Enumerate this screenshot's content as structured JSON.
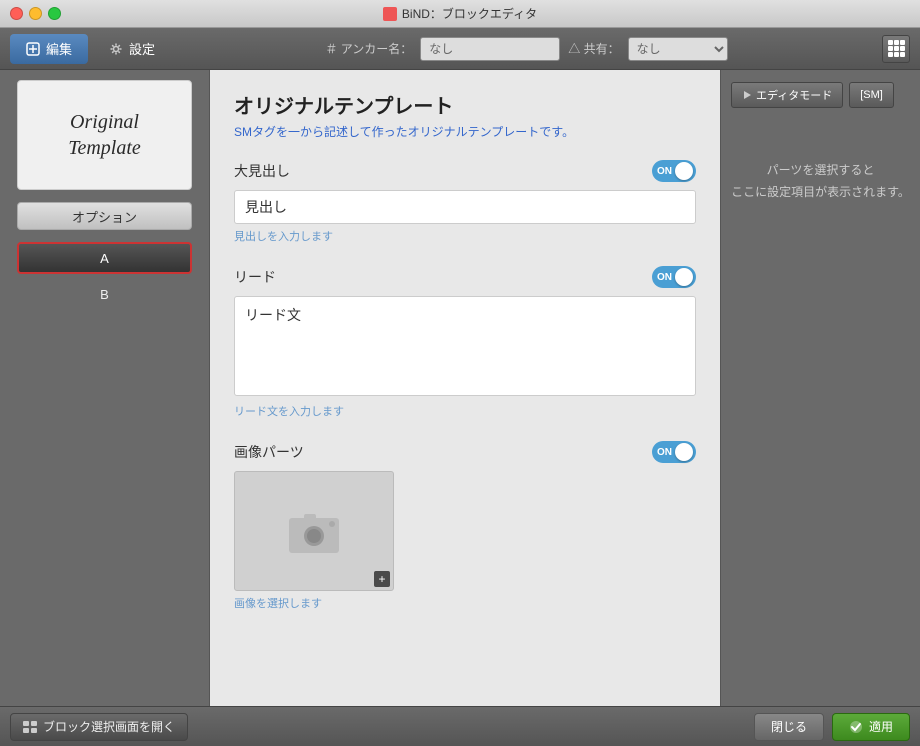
{
  "titleBar": {
    "title": "BiND：ブロックエディタ",
    "icon": "▣"
  },
  "toolbar": {
    "editTab": "編集",
    "settingsTab": "設定",
    "anchorLabel": "＃ アンカー名：",
    "anchorValue": "なし",
    "shareLabel": "△ 共有：",
    "shareValue": "なし"
  },
  "rightPanel": {
    "editorModeBtn": "エディタモード",
    "smBtn": "[SM]",
    "hint": "パーツを選択すると\nここに設定項目が表示されます。"
  },
  "sidebar": {
    "previewLine1": "Original",
    "previewLine2": "Template",
    "optionsBtn": "オプション",
    "itemA": "A",
    "itemB": "B"
  },
  "main": {
    "title": "オリジナルテンプレート",
    "subtitle": "SMタグを一から記述して作ったオリジナルテンプレートです。",
    "section1": {
      "label": "大見出し",
      "toggleLabel": "ON",
      "inputValue": "見出し",
      "inputHint": "見出しを入力します"
    },
    "section2": {
      "label": "リード",
      "toggleLabel": "ON",
      "textareaValue": "リード文",
      "textareaHint": "リード文を入力します"
    },
    "section3": {
      "label": "画像パーツ",
      "toggleLabel": "ON",
      "imageHint": "画像を選択します"
    }
  },
  "bottomBar": {
    "openBlockBtn": "ブロック選択画面を開く",
    "closeBtn": "閉じる",
    "applyBtn": "適用"
  }
}
